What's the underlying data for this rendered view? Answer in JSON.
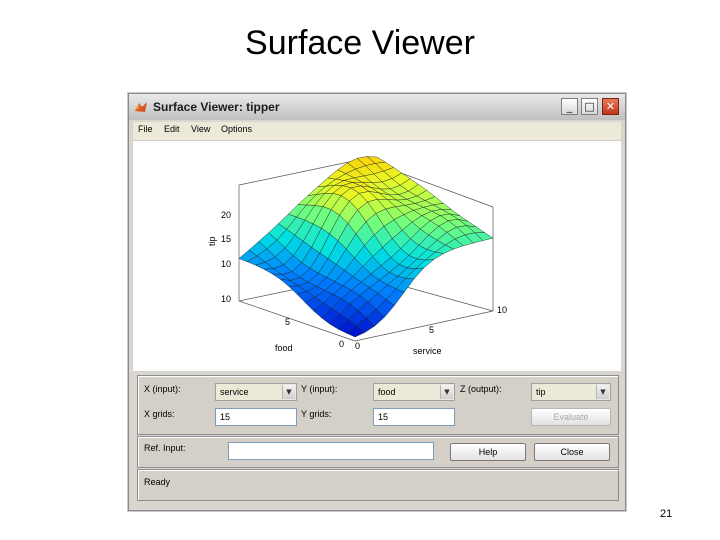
{
  "slide": {
    "title": "Surface Viewer",
    "page_number": "21"
  },
  "window": {
    "title": "Surface Viewer: tipper",
    "controls": {
      "minimize": "_",
      "maximize": "□",
      "close": "✕"
    },
    "menu": [
      "File",
      "Edit",
      "View",
      "Options"
    ]
  },
  "plot": {
    "zlabel": "tip",
    "z_ticks": [
      "20",
      "15",
      "10",
      "10"
    ],
    "food_label": "food",
    "food_ticks": [
      "10",
      "5",
      "0"
    ],
    "service_label": "service",
    "service_ticks": [
      "0",
      "5",
      "10"
    ],
    "grid_size": 15
  },
  "controls": {
    "x_input_label": "X (input):",
    "x_input_value": "service",
    "y_input_label": "Y (input):",
    "y_input_value": "food",
    "z_output_label": "Z (output):",
    "z_output_value": "tip",
    "x_grids_label": "X grids:",
    "x_grids_value": "15",
    "y_grids_label": "Y grids:",
    "y_grids_value": "15",
    "evaluate_label": "Evaluate",
    "ref_input_label": "Ref. Input:",
    "ref_input_value": "",
    "help_label": "Help",
    "close_label": "Close",
    "status": "Ready"
  },
  "colors": {
    "window_bg": "#d8d6cf",
    "plot_bg": "#ffffff",
    "panel_bg": "#d4d0c8"
  }
}
